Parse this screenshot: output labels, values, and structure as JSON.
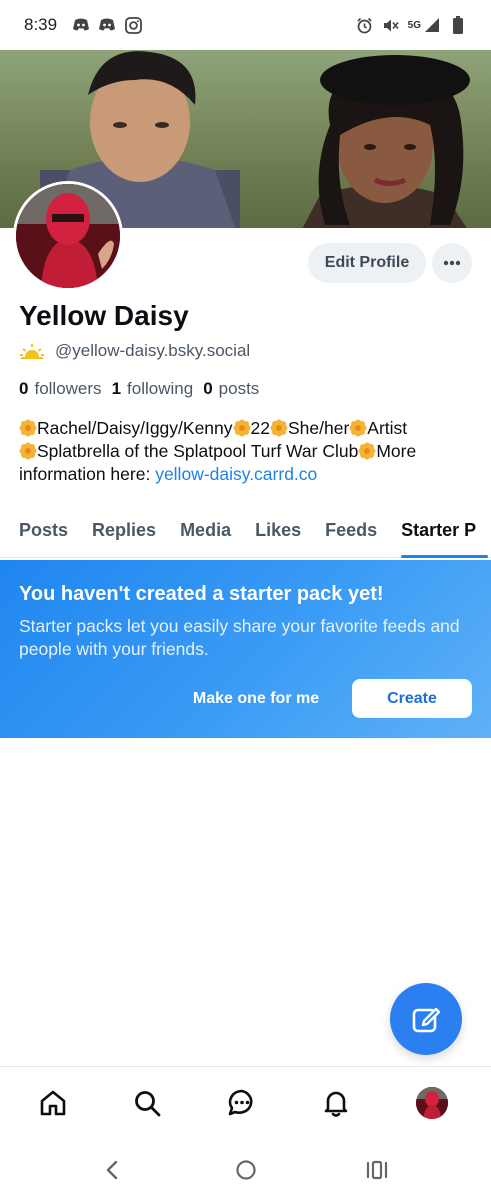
{
  "status_bar": {
    "time": "8:39",
    "network": "5G",
    "left_icons": [
      "discord-icon",
      "discord-icon",
      "instagram-icon"
    ],
    "right_icons": [
      "alarm-icon",
      "mute-icon",
      "signal-icon",
      "battery-icon"
    ]
  },
  "profile": {
    "display_name": "Yellow Daisy",
    "handle": "@yellow-daisy.bsky.social",
    "edit_button": "Edit Profile",
    "stats": {
      "followers_count": "0",
      "followers_label": "followers",
      "following_count": "1",
      "following_label": "following",
      "posts_count": "0",
      "posts_label": "posts"
    },
    "bio": {
      "seg1": "Rachel/Daisy/Iggy/Kenny",
      "seg2": "22",
      "seg3": "She/her",
      "seg4": "Artist",
      "seg5": "Splatbrella of the Splatpool Turf War Club",
      "seg6": "More information here: ",
      "link": "yellow-daisy.carrd.co"
    }
  },
  "tabs": [
    {
      "label": "Posts"
    },
    {
      "label": "Replies"
    },
    {
      "label": "Media"
    },
    {
      "label": "Likes"
    },
    {
      "label": "Feeds"
    },
    {
      "label": "Starter P"
    }
  ],
  "active_tab": "Starter P",
  "starter_pack": {
    "title": "You haven't created a starter pack yet!",
    "description": "Starter packs let you easily share your favorite feeds and people with your friends.",
    "make_button": "Make one for me",
    "create_button": "Create"
  },
  "colors": {
    "accent": "#1d83e6",
    "card_gradient_start": "#1f86ef",
    "card_gradient_end": "#5fb1f6",
    "fab": "#2c7ff0"
  }
}
